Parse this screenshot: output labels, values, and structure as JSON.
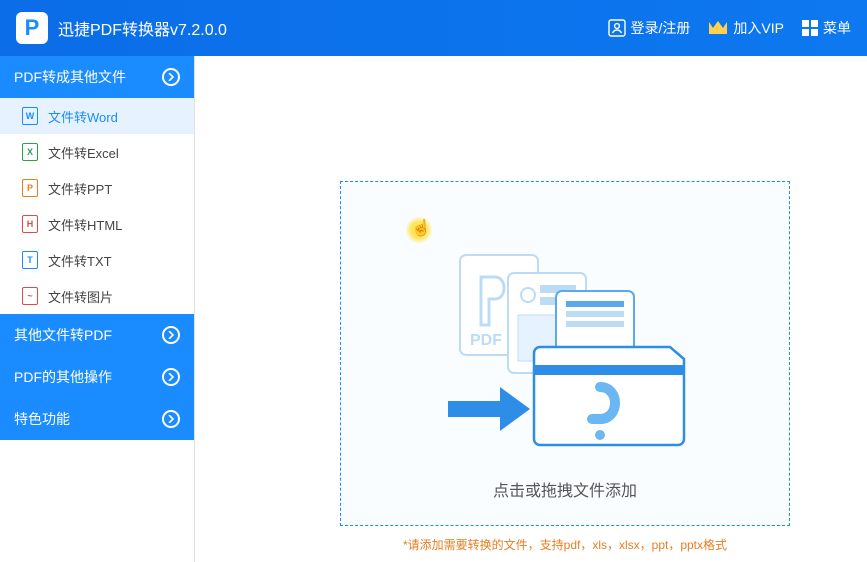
{
  "titlebar": {
    "app_title": "迅捷PDF转换器v7.2.0.0",
    "login": "登录/注册",
    "vip": "加入VIP",
    "menu": "菜单"
  },
  "sidebar": {
    "cat0": {
      "label": "PDF转成其他文件"
    },
    "items": [
      {
        "label": "文件转Word",
        "icon": "W"
      },
      {
        "label": "文件转Excel",
        "icon": "X"
      },
      {
        "label": "文件转PPT",
        "icon": "P"
      },
      {
        "label": "文件转HTML",
        "icon": "H"
      },
      {
        "label": "文件转TXT",
        "icon": "T"
      },
      {
        "label": "文件转图片",
        "icon": "~"
      }
    ],
    "cat1": {
      "label": "其他文件转PDF"
    },
    "cat2": {
      "label": "PDF的其他操作"
    },
    "cat3": {
      "label": "特色功能"
    }
  },
  "main": {
    "dropzone_text": "点击或拖拽文件添加",
    "hint": "*请添加需要转换的文件，支持pdf，xls，xlsx，ppt，pptx格式"
  }
}
